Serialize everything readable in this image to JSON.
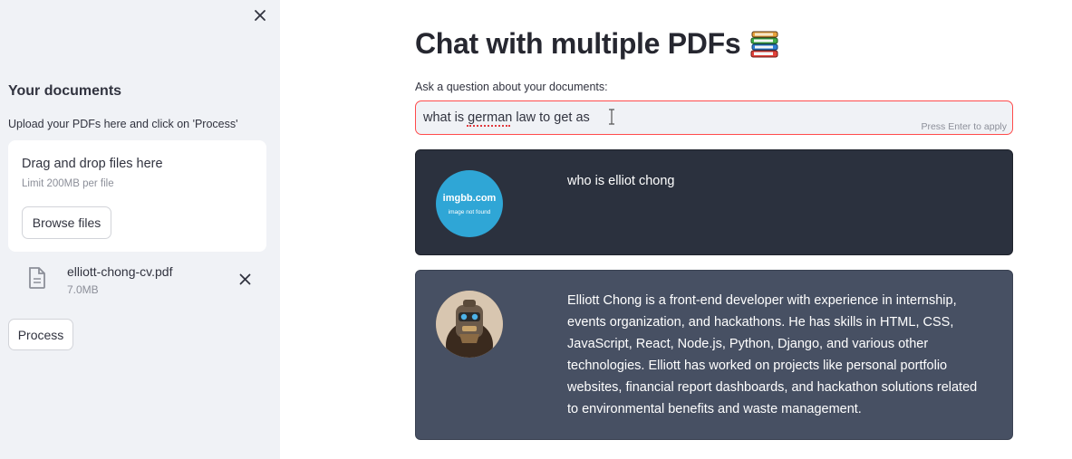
{
  "sidebar": {
    "title": "Your documents",
    "caption": "Upload your PDFs here and click on 'Process'",
    "dropzone": {
      "title": "Drag and drop files here",
      "limit": "Limit 200MB per file",
      "browse_label": "Browse files"
    },
    "file": {
      "name": "elliott-chong-cv.pdf",
      "size": "7.0MB"
    },
    "process_label": "Process"
  },
  "main": {
    "title": "Chat with multiple PDFs",
    "title_icon": "books-emoji-icon",
    "question_label": "Ask a question about your documents:",
    "question_value": "what is german law to get as",
    "enter_hint": "Press Enter to apply",
    "messages": [
      {
        "role": "user",
        "avatar_line1": "imgbb.com",
        "avatar_line2": "image not found",
        "text": "who is elliot chong"
      },
      {
        "role": "bot",
        "avatar": "robot-avatar",
        "text": "Elliott Chong is a front-end developer with experience in internship, events organization, and hackathons. He has skills in HTML, CSS, JavaScript, React, Node.js, Python, Django, and various other technologies. Elliott has worked on projects like personal portfolio websites, financial report dashboards, and hackathon solutions related to environmental benefits and waste management."
      }
    ]
  },
  "colors": {
    "sidebar_bg": "#f0f2f6",
    "accent": "#ff4b4b",
    "user_msg_bg": "#2b313e",
    "bot_msg_bg": "#475063",
    "user_avatar_bg": "#2fa6d6"
  }
}
